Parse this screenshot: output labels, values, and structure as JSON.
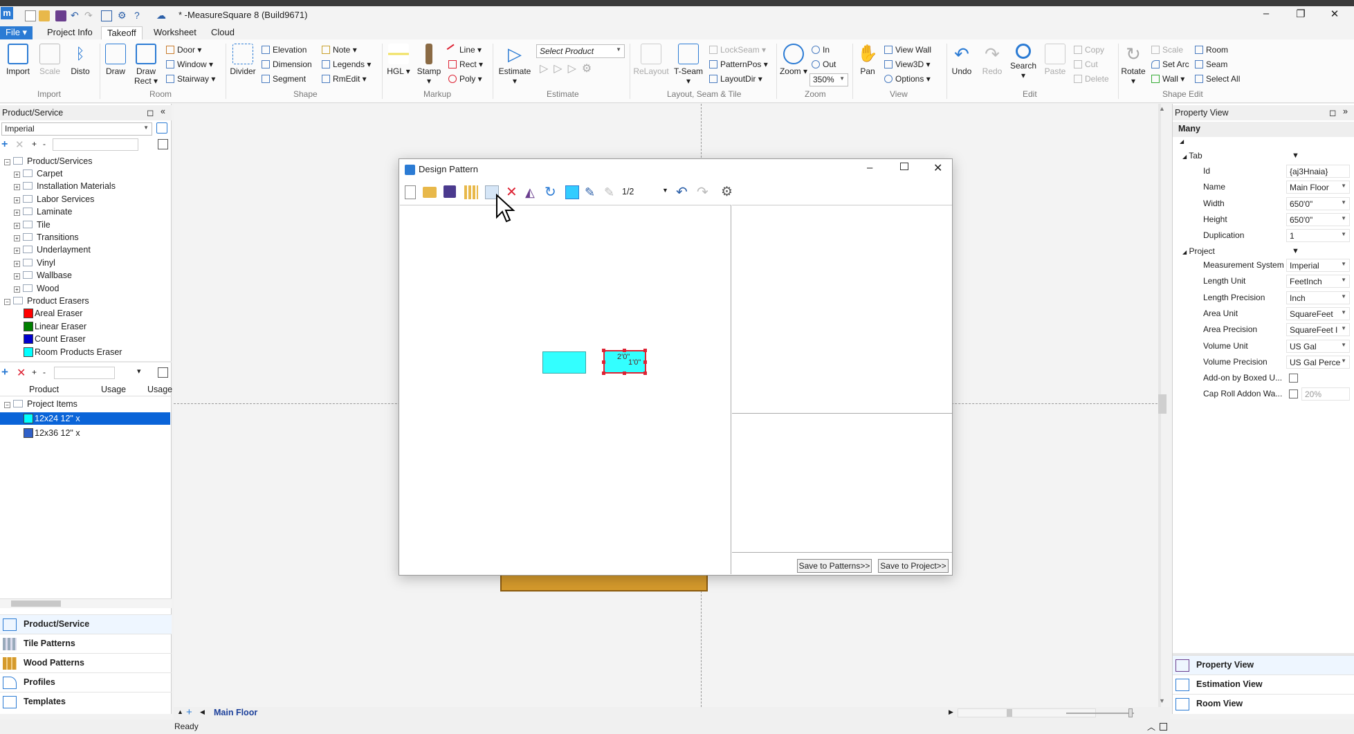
{
  "app": {
    "title": "* -MeasureSquare 8 (Build9671)",
    "logo": "m",
    "window_controls": [
      "–",
      "❐",
      "✕"
    ]
  },
  "menu": {
    "file": "File ▾",
    "tabs": [
      "Project Info",
      "Takeoff",
      "Worksheet",
      "Cloud"
    ],
    "active_tab": "Takeoff"
  },
  "ribbon": {
    "import": "Import",
    "scale": "Scale",
    "disto": "Disto",
    "draw": "Draw",
    "draw_rect": "Draw Rect ▾",
    "door": "Door",
    "window": "Window",
    "stairway": "Stairway",
    "divider": "Divider",
    "elevation": "Elevation",
    "dimension": "Dimension",
    "segment": "Segment",
    "note": "Note",
    "legends": "Legends",
    "rmedit": "RmEdit",
    "hgl": "HGL",
    "stamp": "Stamp",
    "line": "Line",
    "rect": "Rect",
    "poly": "Poly",
    "estimate": "Estimate",
    "select_product": "Select Product",
    "relayout": "ReLayout",
    "tseam": "T-Seam",
    "lockseam": "LockSeam",
    "patternpos": "PatternPos",
    "layoutdir": "LayoutDir",
    "zoom": "Zoom",
    "zoom_in": "In",
    "zoom_out": "Out",
    "zoom_level": "350%",
    "pan": "Pan",
    "view_wall": "View Wall",
    "view3d": "View3D",
    "options": "Options",
    "undo": "Undo",
    "redo": "Redo",
    "search": "Search",
    "paste": "Paste",
    "copy": "Copy",
    "cut": "Cut",
    "delete": "Delete",
    "rotate": "Rotate",
    "scale2": "Scale",
    "set_arc": "Set Arc",
    "wall": "Wall",
    "room": "Room",
    "seam": "Seam",
    "select_all": "Select All",
    "groups": {
      "import": "Import",
      "room": "Room",
      "shape": "Shape",
      "markup": "Markup",
      "estimate": "Estimate",
      "layout": "Layout, Seam & Tile",
      "zoom": "Zoom",
      "view": "View",
      "edit": "Edit",
      "shape_edit": "Shape Edit"
    }
  },
  "left_panel": {
    "header": "Product/Service",
    "header_buttons": [
      "◻",
      "«"
    ],
    "system": "Imperial",
    "tree_root": "Product/Services",
    "categories": [
      "Carpet",
      "Installation Materials",
      "Labor Services",
      "Laminate",
      "Tile",
      "Transitions",
      "Underlayment",
      "Vinyl",
      "Wallbase",
      "Wood"
    ],
    "erasers_root": "Product Erasers",
    "erasers": [
      {
        "label": "Areal Eraser",
        "color": "#ff0000"
      },
      {
        "label": "Linear Eraser",
        "color": "#008000"
      },
      {
        "label": "Count Eraser",
        "color": "#0000cc"
      },
      {
        "label": "Room Products Eraser",
        "color": "#00ffff"
      }
    ],
    "columns": [
      "Product",
      "Usage",
      "Usage"
    ],
    "project_items_root": "Project Items",
    "project_items": [
      {
        "label": "12x24 12\" x",
        "color": "#00ffff",
        "selected": true
      },
      {
        "label": "12x36 12\" x",
        "color": "#3060c8",
        "selected": false
      }
    ],
    "nav": [
      "Product/Service",
      "Tile Patterns",
      "Wood Patterns",
      "Profiles",
      "Templates"
    ]
  },
  "dialog": {
    "title": "Design Pattern",
    "page_indicator": "1/2",
    "tile_label_a": "2'0\"",
    "tile_label_b": "1'0\"",
    "save_patterns": "Save to Patterns>>",
    "save_project": "Save to Project>>"
  },
  "canvas": {
    "floor_tab": "Main Floor"
  },
  "right_panel": {
    "header": "Property View",
    "header_buttons": [
      "◻",
      "»"
    ],
    "selection": "Many",
    "tab_section": "Tab",
    "tab_props": [
      {
        "label": "Id",
        "value": "{aj3Hnaia}"
      },
      {
        "label": "Name",
        "value": "Main Floor"
      },
      {
        "label": "Width",
        "value": "650'0\""
      },
      {
        "label": "Height",
        "value": "650'0\""
      },
      {
        "label": "Duplication",
        "value": "1"
      }
    ],
    "project_section": "Project",
    "project_props": [
      {
        "label": "Measurement System",
        "value": "Imperial"
      },
      {
        "label": "Length Unit",
        "value": "FeetInch"
      },
      {
        "label": "Length Precision",
        "value": "Inch"
      },
      {
        "label": "Area Unit",
        "value": "SquareFeet"
      },
      {
        "label": "Area Precision",
        "value": "SquareFeet I"
      },
      {
        "label": "Volume Unit",
        "value": "US Gal"
      },
      {
        "label": "Volume Precision",
        "value": "US Gal Perce"
      },
      {
        "label": "Add-on by Boxed U...",
        "value": ""
      },
      {
        "label": "Cap Roll Addon Wa...",
        "value": "20%"
      }
    ],
    "nav": [
      "Property View",
      "Estimation View",
      "Room View"
    ]
  },
  "status": {
    "text": "Ready"
  },
  "colors": {
    "accent": "#2b7bd4",
    "tile": "#33ffff",
    "selection": "#0a64d8",
    "floor_board": "#d59a2c"
  }
}
